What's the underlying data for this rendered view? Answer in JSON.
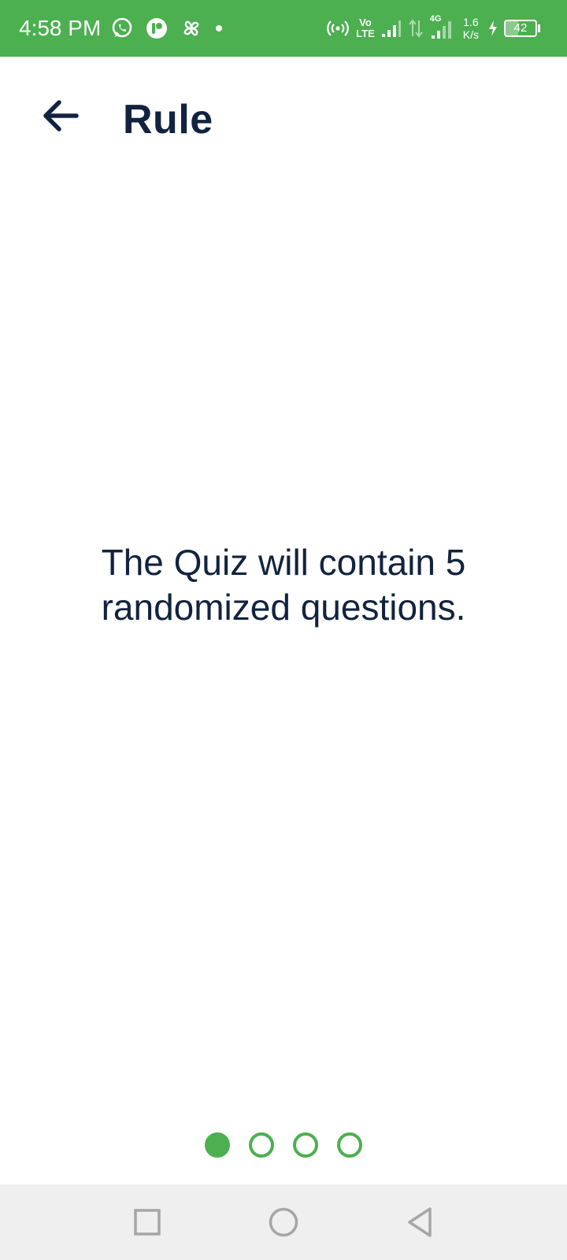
{
  "status_bar": {
    "time": "4:58 PM",
    "volte_top": "Vo",
    "volte_bottom": "LTE",
    "network_type": "4G",
    "speed_value": "1.6",
    "speed_unit": "K/s",
    "battery_level": "42",
    "icons": [
      "whatsapp-icon",
      "app-notification-icon",
      "pinwheel-icon",
      "notification-dot-icon",
      "hotspot-icon",
      "signal-icon",
      "data-transfer-icon",
      "signal-4g-icon",
      "charging-icon",
      "battery-icon"
    ]
  },
  "header": {
    "title": "Rule",
    "back_icon": "arrow-left-icon"
  },
  "content": {
    "rule_text": "The Quiz will contain 5 randomized questions."
  },
  "pager": {
    "total_pages": 4,
    "current_page": 1
  },
  "nav_bar": {
    "icons": [
      "recents-square-icon",
      "home-circle-icon",
      "back-triangle-icon"
    ]
  },
  "colors": {
    "status_bar": "#4caf50",
    "accent": "#4caf50",
    "title_text": "#12233f",
    "nav_bar": "#efefef"
  }
}
